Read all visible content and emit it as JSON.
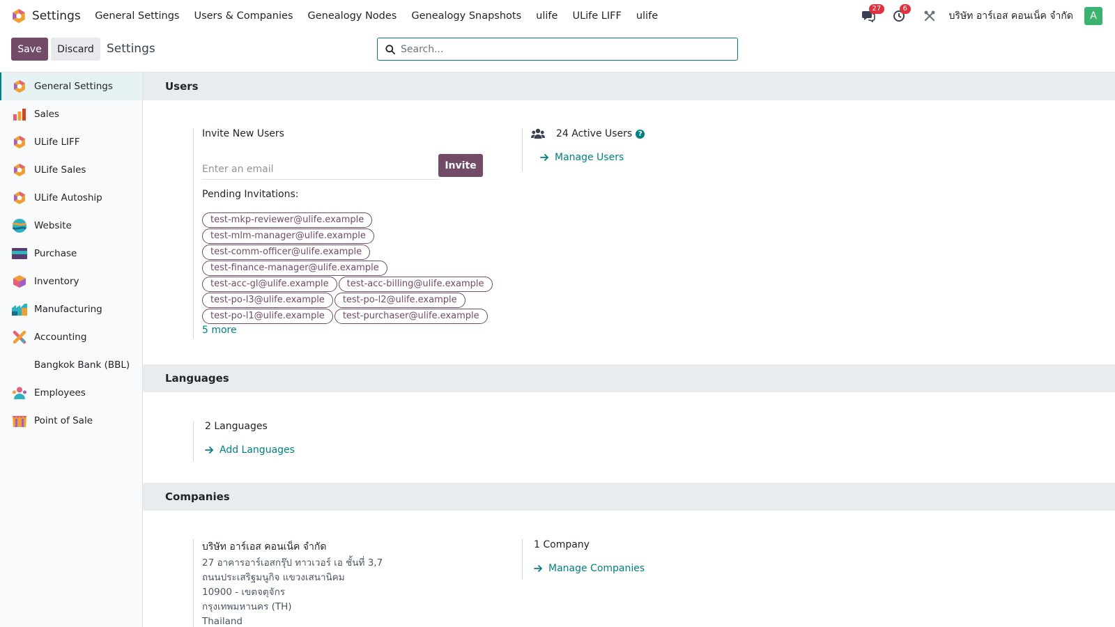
{
  "app": {
    "title": "Settings",
    "menu": [
      "General Settings",
      "Users & Companies",
      "Genealogy Nodes",
      "Genealogy Snapshots",
      "ulife",
      "ULife LIFF",
      "ulife"
    ],
    "messages_count": "27",
    "activities_count": "6",
    "company_name": "บริษัท อาร์เอส คอนเน็ค จำกัด",
    "avatar_initial": "A"
  },
  "control_panel": {
    "save_label": "Save",
    "discard_label": "Discard",
    "title": "Settings",
    "search_placeholder": "Search..."
  },
  "sidebar": {
    "items": [
      {
        "label": "General Settings",
        "icon": "odoo-logo-icon",
        "active": true
      },
      {
        "label": "Sales",
        "icon": "sales-chart-icon"
      },
      {
        "label": "ULife LIFF",
        "icon": "odoo-logo-icon"
      },
      {
        "label": "ULife Sales",
        "icon": "odoo-logo-icon"
      },
      {
        "label": "ULife Autoship",
        "icon": "odoo-logo-icon"
      },
      {
        "label": "Website",
        "icon": "website-globe-icon"
      },
      {
        "label": "Purchase",
        "icon": "purchase-card-icon"
      },
      {
        "label": "Inventory",
        "icon": "inventory-box-icon"
      },
      {
        "label": "Manufacturing",
        "icon": "manufacturing-factory-icon"
      },
      {
        "label": "Accounting",
        "icon": "accounting-cross-icon"
      },
      {
        "label": "Bangkok Bank (BBL)",
        "icon": ""
      },
      {
        "label": "Employees",
        "icon": "employees-people-icon"
      },
      {
        "label": "Point of Sale",
        "icon": "pos-shop-icon"
      }
    ]
  },
  "users": {
    "heading": "Users",
    "invite_title": "Invite New Users",
    "email_placeholder": "Enter an email",
    "invite_button": "Invite",
    "pending_label": "Pending Invitations:",
    "pending": [
      "test-mkp-reviewer@ulife.example",
      "test-mlm-manager@ulife.example",
      "test-comm-officer@ulife.example",
      "test-finance-manager@ulife.example",
      "test-acc-gl@ulife.example",
      "test-acc-billing@ulife.example",
      "test-po-l3@ulife.example",
      "test-po-l2@ulife.example",
      "test-po-l1@ulife.example",
      "test-purchaser@ulife.example"
    ],
    "more_label": "5 more",
    "active_users": "24 Active Users",
    "manage_users": "Manage Users"
  },
  "languages": {
    "heading": "Languages",
    "count_label": "2 Languages",
    "add_label": "Add Languages"
  },
  "companies": {
    "heading": "Companies",
    "company_name": "บริษัท อาร์เอส คอนเน็ค จำกัด",
    "address_lines": [
      "27 อาคารอาร์เอสกรุ๊ป ทาวเวอร์ เอ ชั้นที่ 3,7",
      "ถนนประเสริฐมนูกิจ แขวงเสนานิคม",
      "10900 - เขตจตุจักร",
      "กรุงเทพมหานคร (TH)",
      "Thailand"
    ],
    "count_label": "1 Company",
    "manage_label": "Manage Companies"
  },
  "colors": {
    "primary": "#714b67",
    "link": "#017e84",
    "badge": "#e0313f",
    "avatar": "#3cb371"
  }
}
